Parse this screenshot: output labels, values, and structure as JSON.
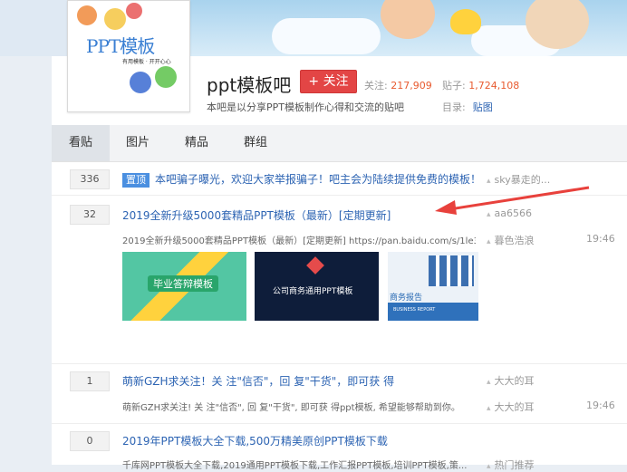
{
  "banner": {
    "logo_text": "PPT模板",
    "logo_small": "有用模板 · 开开心心"
  },
  "forum": {
    "title": "ppt模板吧",
    "follow_label": "+ 关注",
    "stats": {
      "follow_label": "关注:",
      "follow_count": "217,909",
      "posts_label": "贴子:",
      "posts_count": "1,724,108"
    },
    "description": "本吧是以分享PPT模板制作心得和交流的贴吧",
    "directory_label": "目录:",
    "directory_link": "贴图"
  },
  "tabs": [
    {
      "label": "看贴"
    },
    {
      "label": "图片"
    },
    {
      "label": "精品"
    },
    {
      "label": "群组"
    }
  ],
  "threads": [
    {
      "replies": "336",
      "badge": "置顶",
      "title": "本吧骗子曝光，欢迎大家举报骗子！吧主会为陆续提供免费的模板！",
      "author": "sky暴走的..."
    },
    {
      "replies": "32",
      "title": "2019全新升级5000套精品PPT模板（最新）[定期更新]",
      "author": "aa6566",
      "abstract": "2019全新升级5000套精品PPT模板（最新）[定期更新] https://pan.baidu.com/s/1le3i...",
      "last_reply": "暮色浩浪",
      "time": "19:46",
      "thumbs": [
        "毕业答辩模板",
        "公司商务通用PPT模板",
        "商务报告",
        "BUSINESS REPORT"
      ]
    },
    {
      "replies": "1",
      "title": "萌新GZH求关注！关 注\"信否\"，回 复\"干货\"，即可获 得",
      "author": "大大的耳",
      "abstract": "萌新GZH求关注! 关 注\"信否\", 回 复\"干货\", 即可获 得ppt模板, 希望能够帮助到你。",
      "last_reply": "大大的耳",
      "time": "19:46"
    },
    {
      "replies": "0",
      "title": "2019年PPT模板大全下载,500万精美原创PPT模板下载",
      "author": "热门推荐",
      "abstract": "千库网PPT模板大全下载,2019通用PPT模板下载,工作汇报PPT模板,培训PPT模板,策..."
    }
  ],
  "colors": {
    "link": "#2d64b3",
    "accent": "#e34545",
    "badge": "#4a8fe0",
    "arrow": "#e8413c"
  }
}
